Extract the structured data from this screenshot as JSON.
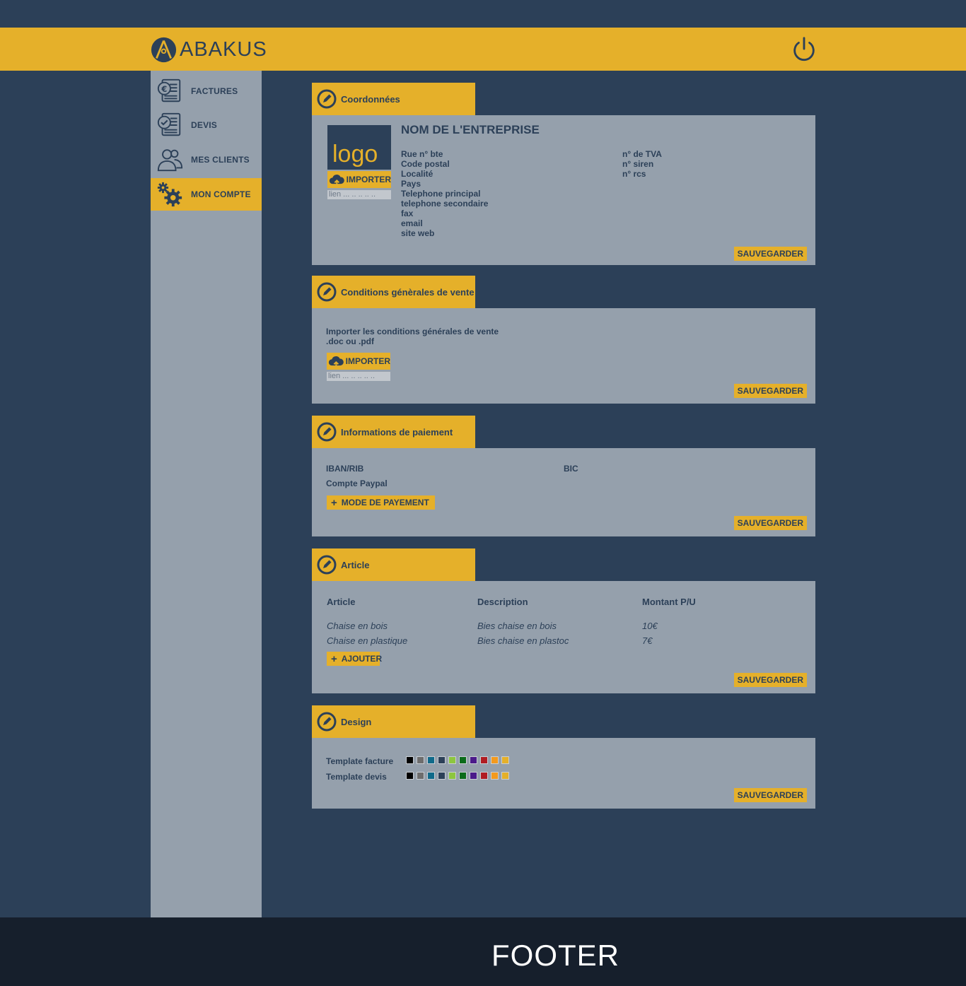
{
  "header": {
    "app_name": "ABAKUS",
    "logo_icon": "abakus-logo",
    "power_icon": "power-icon"
  },
  "colors": {
    "accent": "#e5b02a",
    "navy": "#2c4058",
    "panel": "#95a0ac",
    "footer": "#161f2c"
  },
  "sidebar": {
    "items": [
      {
        "label": "FACTURES",
        "icon": "invoice-euro-icon",
        "active": false
      },
      {
        "label": "DEVIS",
        "icon": "quote-check-icon",
        "active": false
      },
      {
        "label": "MES CLIENTS",
        "icon": "users-icon",
        "active": false
      },
      {
        "label": "MON COMPTE",
        "icon": "gears-icon",
        "active": true
      }
    ]
  },
  "coordonnees": {
    "title": "Coordonnées",
    "logo_text": "logo",
    "import_label": "IMPORTER",
    "link_placeholder": "lien ... .. .. .. ..",
    "company_name": "NOM DE L'ENTREPRISE",
    "fields_left": [
      "Rue n° bte",
      "Code postal",
      "Localité",
      "Pays",
      "Telephone principal",
      "telephone secondaire",
      "fax",
      "email",
      "site web"
    ],
    "fields_right": [
      "n° de TVA",
      "n° siren",
      "n° rcs"
    ],
    "save_label": "SAUVEGARDER"
  },
  "cgv": {
    "title": "Conditions génèrales de vente",
    "desc_line1": "Importer les conditions générales de vente",
    "desc_line2": ".doc ou .pdf",
    "import_label": "IMPORTER",
    "link_placeholder": "lien ... .. .. .. ..",
    "save_label": "SAUVEGARDER"
  },
  "paiement": {
    "title": "Informations de paiement",
    "iban_label": "IBAN/RIB",
    "bic_label": "BIC",
    "paypal_label": "Compte Paypal",
    "add_label": "MODE DE PAYEMENT",
    "save_label": "SAUVEGARDER"
  },
  "article": {
    "title": "Article",
    "columns": [
      "Article",
      "Description",
      "Montant P/U"
    ],
    "rows": [
      [
        "Chaise en bois",
        "Bies chaise en bois",
        "10€"
      ],
      [
        "Chaise en plastique",
        "Bies chaise en plastoc",
        "7€"
      ]
    ],
    "add_label": "AJOUTER",
    "save_label": "SAUVEGARDER"
  },
  "design": {
    "title": "Design",
    "template_facture_label": "Template facture",
    "template_devis_label": "Template devis",
    "palette": [
      "#000000",
      "#6d6d6d",
      "#0f6a8a",
      "#2c4058",
      "#8dc63f",
      "#0a6b1a",
      "#4b1a8a",
      "#b01c22",
      "#f39a1e",
      "#e5b02a"
    ],
    "save_label": "SAUVEGARDER"
  },
  "footer": {
    "text": "FOOTER"
  }
}
